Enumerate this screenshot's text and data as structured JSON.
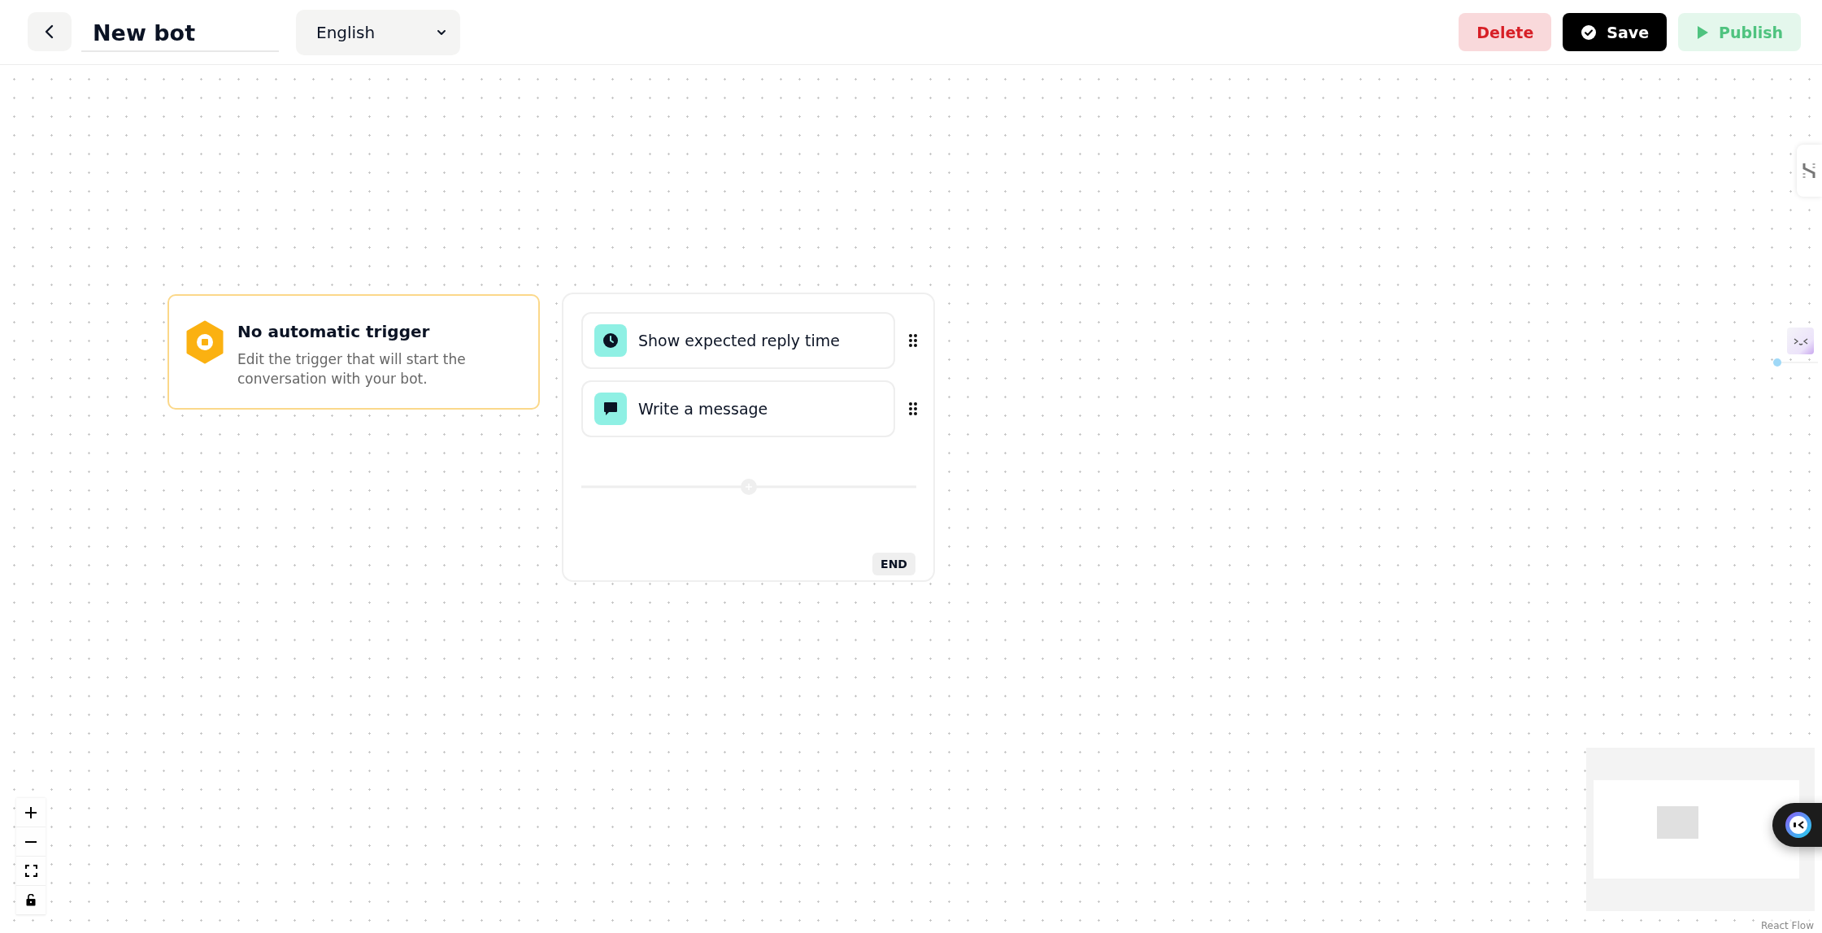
{
  "header": {
    "title": "New bot",
    "language": "English",
    "buttons": [
      {
        "label": "Delete",
        "kind": "danger"
      },
      {
        "label": "Save",
        "kind": "primary"
      },
      {
        "label": "Publish",
        "kind": "success"
      }
    ]
  },
  "canvas": {
    "trigger": {
      "title": "No automatic trigger",
      "description": "Edit the trigger that will start the conversation with your bot."
    },
    "steps": [
      {
        "label": "Show expected reply time",
        "kind": "clock"
      },
      {
        "label": "Write a message",
        "kind": "message"
      }
    ],
    "end_label": "END",
    "attribution": "React Flow"
  }
}
